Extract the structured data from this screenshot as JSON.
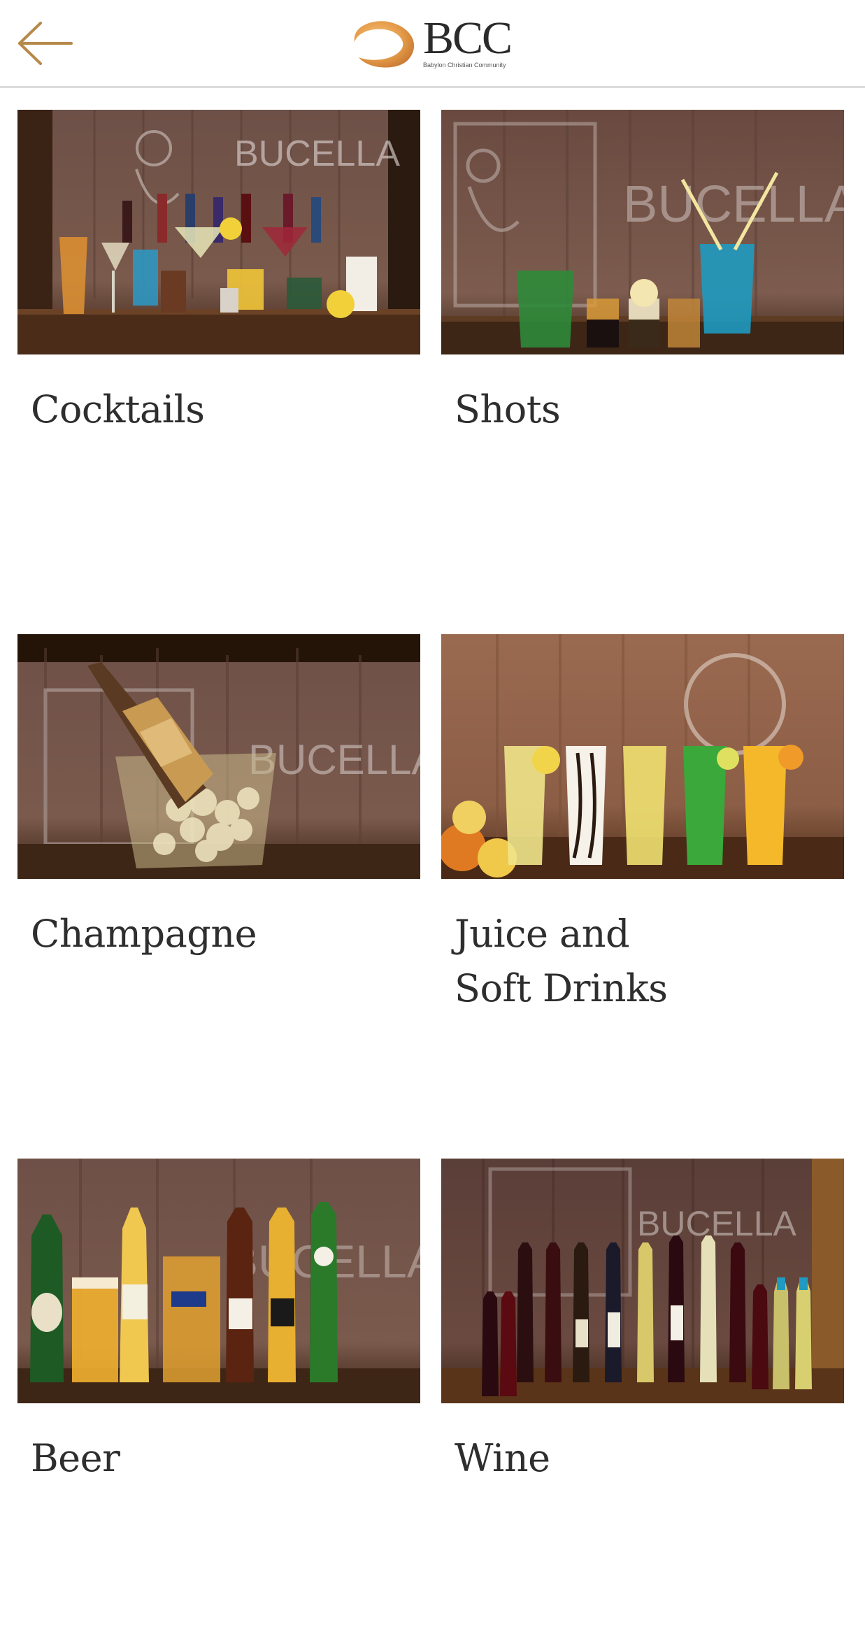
{
  "header": {
    "back_icon": "arrow-left-icon",
    "logo": {
      "title": "BCC",
      "subtitle": "Babylon Christian Community"
    },
    "accent_color": "#b68a4a"
  },
  "categories": [
    {
      "label": "Cocktails"
    },
    {
      "label": "Shots"
    },
    {
      "label": "Champagne"
    },
    {
      "label": "Juice and\nSoft Drinks"
    },
    {
      "label": "Beer"
    },
    {
      "label": "Wine"
    }
  ],
  "photo_sign_text": "BUCELLA"
}
